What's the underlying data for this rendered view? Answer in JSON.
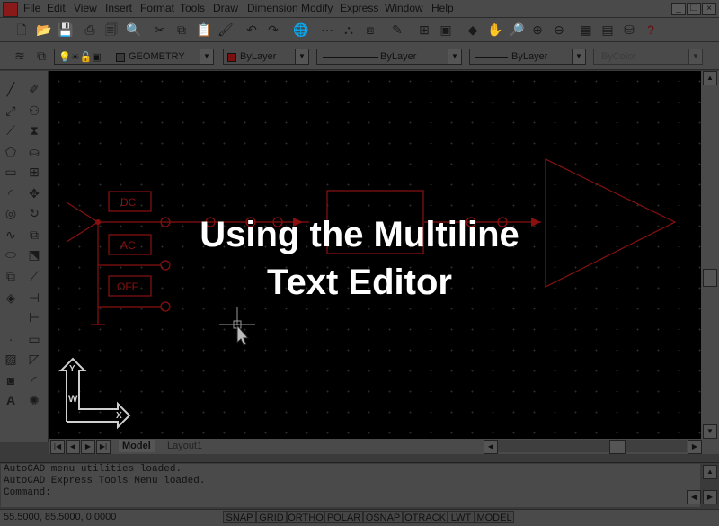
{
  "menu": [
    "File",
    "Edit",
    "View",
    "Insert",
    "Format",
    "Tools",
    "Draw",
    "Dimension",
    "Modify",
    "Express",
    "Window",
    "Help"
  ],
  "layer_combo": {
    "name": "GEOMETRY"
  },
  "color_combo": {
    "value": "ByLayer"
  },
  "linetype_combo": {
    "value": "ByLayer"
  },
  "lineweight_combo": {
    "value": "ByLayer"
  },
  "plotstyle_combo": {
    "value": "ByColor"
  },
  "drawing": {
    "labels": [
      "DC",
      "AC",
      "OFF"
    ]
  },
  "overlay": {
    "line1": "Using the Multiline",
    "line2": "Text Editor"
  },
  "ucs": {
    "y_label": "Y",
    "w_label": "W",
    "x_label": "X"
  },
  "tabs": {
    "model": "Model",
    "layout1": "Layout1"
  },
  "command_lines": [
    "AutoCAD menu utilities loaded.",
    "AutoCAD Express Tools Menu loaded.",
    "Command:"
  ],
  "status": {
    "coords": "55.5000, 85.5000, 0.0000",
    "buttons": [
      "SNAP",
      "GRID",
      "ORTHO",
      "POLAR",
      "OSNAP",
      "OTRACK",
      "LWT",
      "MODEL"
    ]
  }
}
